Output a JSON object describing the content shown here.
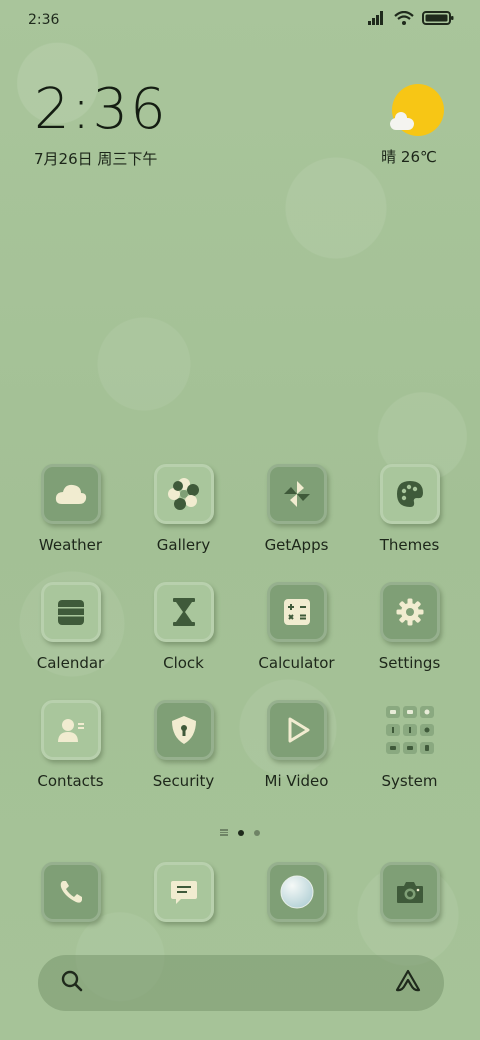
{
  "status_bar": {
    "time": "2:36"
  },
  "clock_widget": {
    "time": "2:36",
    "date": "7月26日 周三下午"
  },
  "weather_widget": {
    "text": "晴 26℃"
  },
  "apps": [
    {
      "label": "Weather",
      "icon": "cloud-icon"
    },
    {
      "label": "Gallery",
      "icon": "flower-icon"
    },
    {
      "label": "GetApps",
      "icon": "pinwheel-icon"
    },
    {
      "label": "Themes",
      "icon": "palette-icon"
    },
    {
      "label": "Calendar",
      "icon": "calendar-icon"
    },
    {
      "label": "Clock",
      "icon": "hourglass-icon"
    },
    {
      "label": "Calculator",
      "icon": "calculator-icon"
    },
    {
      "label": "Settings",
      "icon": "gear-icon"
    },
    {
      "label": "Contacts",
      "icon": "person-icon"
    },
    {
      "label": "Security",
      "icon": "shield-icon"
    },
    {
      "label": "Mi Video",
      "icon": "play-icon"
    },
    {
      "label": "System",
      "icon": "folder-grid-icon"
    }
  ],
  "dock": [
    {
      "icon": "phone-icon"
    },
    {
      "icon": "message-icon"
    },
    {
      "icon": "browser-icon"
    },
    {
      "icon": "camera-icon"
    }
  ],
  "page_indicator": {
    "pages": 2,
    "active": 1
  },
  "colors": {
    "background": "#a8c49a",
    "tile_dark": "#7f9f76",
    "tile_light": "#a9c69c",
    "sun": "#f7c615"
  }
}
